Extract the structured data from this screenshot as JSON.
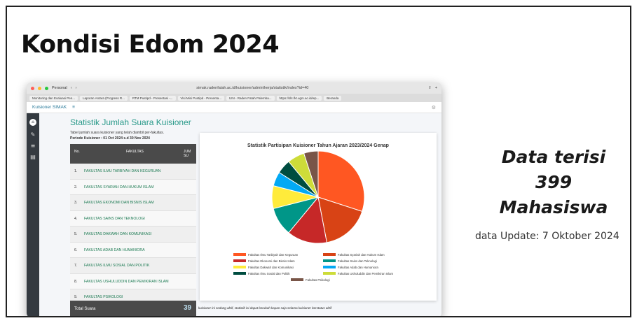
{
  "slide": {
    "title": "Kondisi Edom 2024",
    "stat_line1": "Data terisi",
    "stat_line2": "399",
    "stat_line3": "Mahasiswa",
    "update": "data Update: 7 Oktober 2024"
  },
  "browser": {
    "profile": "Personal",
    "url": "simak.radenfatah.ac.id/kuisioner/admin/kerja/statistik/index?id=40",
    "tabs": [
      "Monitoring dan Evaluasi Pen...",
      "Laporan Antara (Progress R...",
      "RTM Pustipd - Presentasi -...",
      "Visi Misi Pustipd - Presenta...",
      "UIN - Raden Fatah Palemba...",
      "https://dlc.fkt.ugm.ac.id/wp...",
      "Beranda"
    ]
  },
  "app": {
    "name": "Kuisioner SIMAK",
    "menu_icon": "≡",
    "page_title": "Statistik Jumlah Suara Kuisioner",
    "desc1": "Tabel jumlah suara kuisioner yang telah diambil per-fakultas.",
    "desc2": "Periode Kuisioner : 01 Oct 2024 s.d 30 Nov 2024",
    "table": {
      "col_no": "No.",
      "col_fak": "FAKULTAS",
      "col_jml": "JUM SU",
      "rows": [
        {
          "no": "1.",
          "fak": "FAKULTAS ILMU TARBIYAH DAN KEGURUAN"
        },
        {
          "no": "2.",
          "fak": "FAKULTAS SYARIAH DAN HUKUM ISLAM"
        },
        {
          "no": "3.",
          "fak": "FAKULTAS EKONOMI DAN BISNIS ISLAM"
        },
        {
          "no": "4.",
          "fak": "FAKULTAS SAINS DAN TEKNOLOGI"
        },
        {
          "no": "5.",
          "fak": "FAKULTAS DAKWAH DAN KOMUNIKASI"
        },
        {
          "no": "6.",
          "fak": "FAKULTAS ADAB DAN HUMANIORA"
        },
        {
          "no": "7.",
          "fak": "FAKULTAS ILMU SOSIAL DAN POLITIK"
        },
        {
          "no": "8.",
          "fak": "FAKULTAS USHULUDDIN DAN PEMIKIRAN ISLAM"
        },
        {
          "no": "9.",
          "fak": "FAKULTAS PSIKOLOGI"
        }
      ],
      "total_label": "Total Suara",
      "total_value": "39"
    },
    "note": "kuisioner ini sedang aktif, statistik ini dapat berubah kapan saja selama kuisioner berstatus aktif"
  },
  "chart_data": {
    "type": "pie",
    "title": "Statistik Partisipan Kuisioner Tahun Ajaran 2023/2024 Genap",
    "categories": [
      "Fakultas Ilmu Tarbiyah dan Keguruan",
      "Fakultas Syariah dan Hukum Islam",
      "Fakultas Ekonomi dan Bisnis Islam",
      "Fakultas Sains dan Teknologi",
      "Fakultas Dakwah dan Komunikasi",
      "Fakultas Adab dan Humaniora",
      "Fakultas Ilmu Sosial dan Politik",
      "Fakultas Ushuluddin dan Pemikiran Islam",
      "Fakultas Psikologi"
    ],
    "values": [
      30,
      17,
      14,
      10,
      8,
      5,
      5,
      6,
      5
    ],
    "colors": [
      "#ff5722",
      "#d84315",
      "#c62828",
      "#009688",
      "#ffeb3b",
      "#03a9f4",
      "#004d40",
      "#cddc39",
      "#795548"
    ],
    "legend_position": "bottom"
  }
}
